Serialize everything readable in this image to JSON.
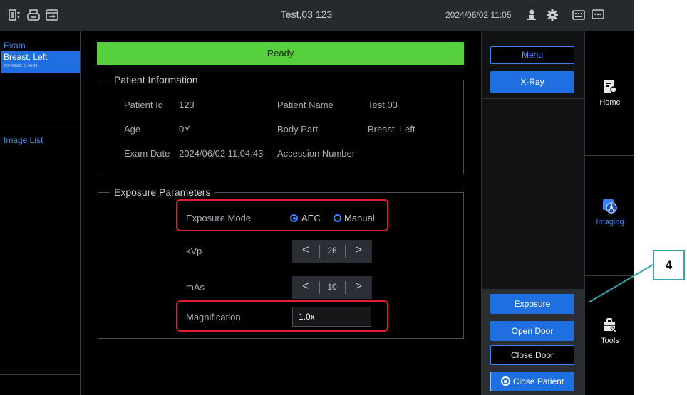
{
  "topbar": {
    "title": "Test,03 123",
    "datetime": "2024/06/02 11:05",
    "left_icons": [
      "worklist-icon",
      "printer-icon",
      "export-icon"
    ],
    "right_icons": [
      "operator-icon",
      "gear-icon",
      "keyboard-icon",
      "message-icon"
    ]
  },
  "left": {
    "exam_header": "Exam",
    "exam_name": "Breast, Left",
    "exam_date": "2024/06/02 11:04:43",
    "image_list": "Image List"
  },
  "status": {
    "ready": "Ready",
    "ready_color": "#57d03d"
  },
  "patient": {
    "legend": "Patient Information",
    "id_label": "Patient Id",
    "id_value": "123",
    "name_label": "Patient Name",
    "name_value": "Test,03",
    "age_label": "Age",
    "age_value": "0Y",
    "bodypart_label": "Body Part",
    "bodypart_value": "Breast, Left",
    "examdate_label": "Exam Date",
    "examdate_value": "2024/06/02 11:04:43",
    "accession_label": "Accession Number",
    "accession_value": ""
  },
  "exposure": {
    "legend": "Exposure Parameters",
    "mode_label": "Exposure Mode",
    "mode_aec": "AEC",
    "mode_manual": "Manual",
    "mode_selected": "AEC",
    "kvp_label": "kVp",
    "kvp_value": "26",
    "mas_label": "mAs",
    "mas_value": "10",
    "magnification_label": "Magnification",
    "magnification_value": "1.0x"
  },
  "controls": {
    "menu": "Menu",
    "xray": "X-Ray",
    "exposure": "Exposure",
    "open_door": "Open Door",
    "close_door": "Close Door",
    "close_patient": "Close Patient"
  },
  "nav": {
    "home": "Home",
    "imaging": "Imaging",
    "tools": "Tools"
  },
  "callout": {
    "number": "4",
    "color": "#35a6a6"
  },
  "colors": {
    "accent": "#1f6fe0",
    "highlight": "#e3202a"
  }
}
